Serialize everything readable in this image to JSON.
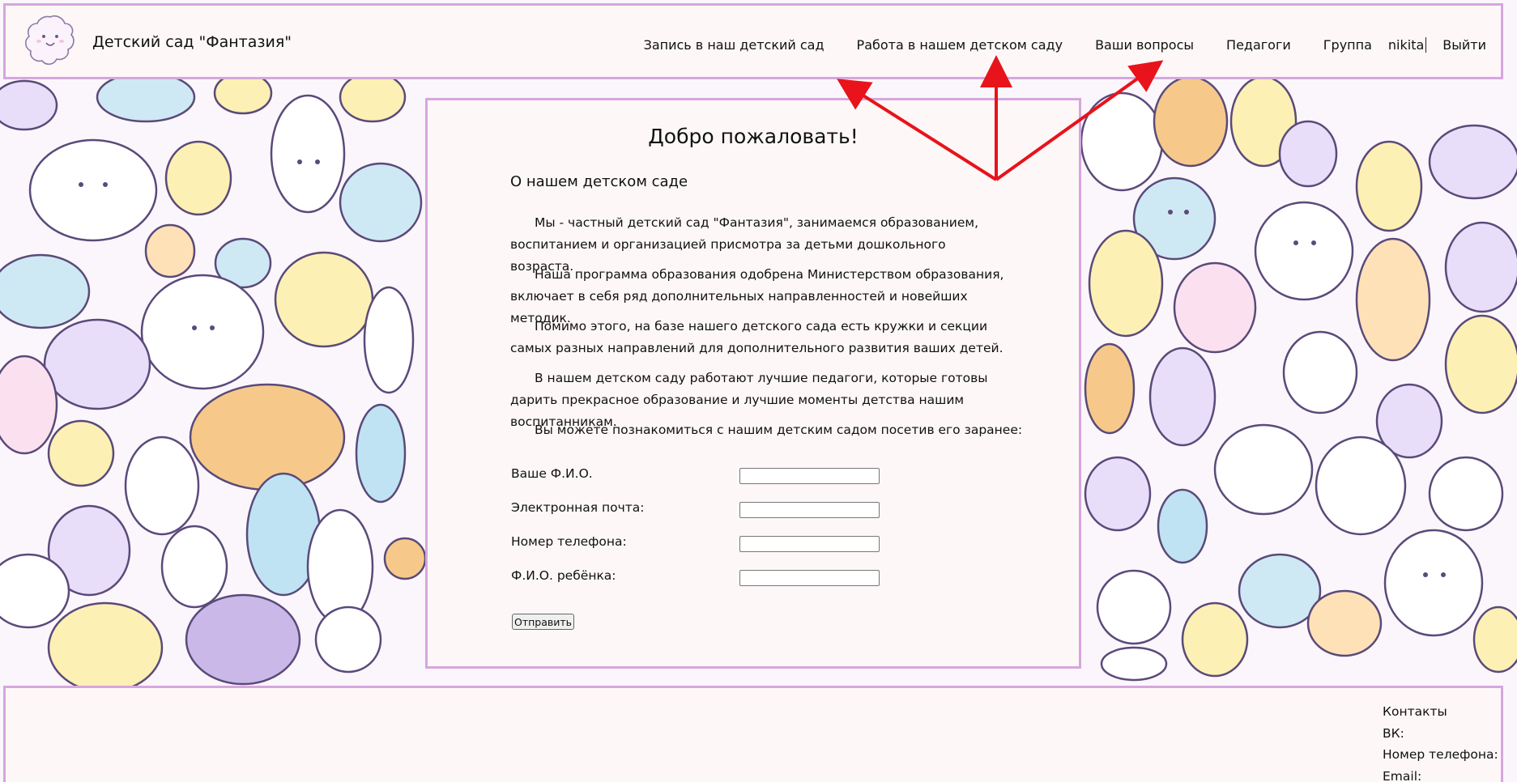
{
  "header": {
    "site_title": "Детский сад \"Фантазия\"",
    "nav": [
      {
        "label": "Запись в наш детский сад"
      },
      {
        "label": "Работа в нашем детском саду"
      },
      {
        "label": "Ваши вопросы"
      },
      {
        "label": "Педагоги"
      },
      {
        "label": "Группа"
      }
    ],
    "user": "nikita",
    "logout": "Выйти"
  },
  "main": {
    "title": "Добро пожаловать!",
    "subtitle": "О нашем детском саде",
    "paragraphs": [
      "Мы - частный детский сад \"Фантазия\", занимаемся образованием, воспитанием и организацией присмотра за детьми дошкольного возраста.",
      "Наша программа образования одобрена Министерством образования, включает в себя ряд дополнительных направленностей и новейших методик.",
      "Помимо этого, на базе нашего детского сада есть кружки и секции самых разных направлений для дополнительного развития ваших детей.",
      "В нашем детском саду работают лучшие педагоги, которые готовы дарить прекрасное образование и лучшие моменты детства нашим воспитанникам.",
      "Вы можете познакомиться с нашим детским садом посетив его заранее:"
    ],
    "form": {
      "fields": [
        {
          "label": "Ваше Ф.И.О.",
          "value": ""
        },
        {
          "label": "Электронная почта:",
          "value": ""
        },
        {
          "label": "Номер телефона:",
          "value": ""
        },
        {
          "label": "Ф.И.О. ребёнка:",
          "value": ""
        }
      ],
      "submit_label": "Отправить"
    }
  },
  "footer": {
    "contacts_title": "Контакты",
    "vk_label": "ВК:",
    "phone_label": "Номер телефона:",
    "email_label": "Email:"
  },
  "colors": {
    "border": "#d6a6de",
    "panel": "#fdf8f7",
    "annotation_arrow": "#e8131b"
  },
  "icons": {
    "logo": "cloud-face-logo-icon"
  }
}
